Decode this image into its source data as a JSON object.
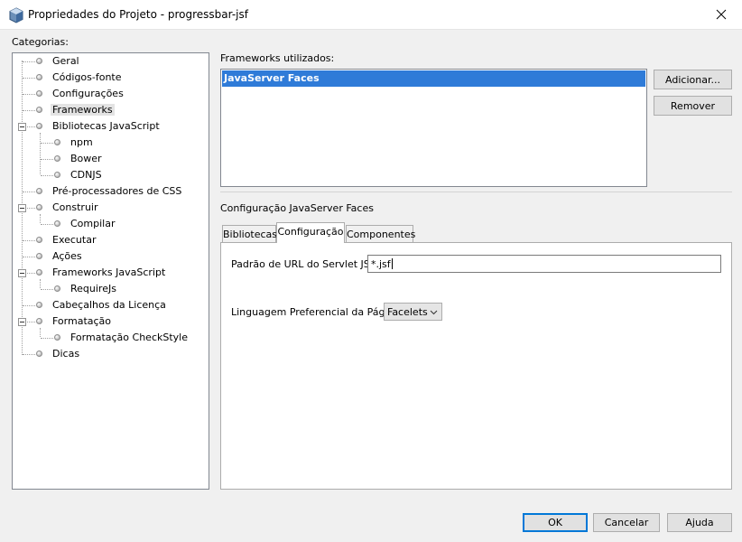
{
  "window": {
    "title": "Propriedades do Projeto - progressbar-jsf",
    "close_icon": "close-icon",
    "app_icon": "project-cube-icon"
  },
  "categories": {
    "label": "Categorias:",
    "items": [
      {
        "label": "Geral"
      },
      {
        "label": "Códigos-fonte"
      },
      {
        "label": "Configurações"
      },
      {
        "label": "Frameworks",
        "selected": true
      },
      {
        "label": "Bibliotecas JavaScript",
        "expanded": true
      },
      {
        "label": "npm"
      },
      {
        "label": "Bower"
      },
      {
        "label": "CDNJS"
      },
      {
        "label": "Pré-processadores de CSS"
      },
      {
        "label": "Construir",
        "expanded": true
      },
      {
        "label": "Compilar"
      },
      {
        "label": "Executar"
      },
      {
        "label": "Ações"
      },
      {
        "label": "Frameworks JavaScript",
        "expanded": true
      },
      {
        "label": "RequireJs"
      },
      {
        "label": "Cabeçalhos da Licença"
      },
      {
        "label": "Formatação",
        "expanded": true
      },
      {
        "label": "Formatação CheckStyle"
      },
      {
        "label": "Dicas"
      }
    ]
  },
  "frameworks": {
    "label": "Frameworks utilizados:",
    "items": [
      "JavaServer Faces"
    ],
    "add_button": "Adicionar...",
    "remove_button": "Remover"
  },
  "config": {
    "title": "Configuração JavaServer Faces",
    "tabs": [
      "Bibliotecas",
      "Configuração",
      "Componentes"
    ],
    "active_tab": "Configuração",
    "url_pattern_label": "Padrão de URL do Servlet JSF:",
    "url_pattern_value": "*.jsf",
    "language_label": "Linguagem Preferencial da Página:",
    "language_value": "Facelets"
  },
  "footer": {
    "ok": "OK",
    "cancel": "Cancelar",
    "help": "Ajuda"
  },
  "colors": {
    "selection": "#2f7bd8",
    "default_button_border": "#0078d7"
  }
}
